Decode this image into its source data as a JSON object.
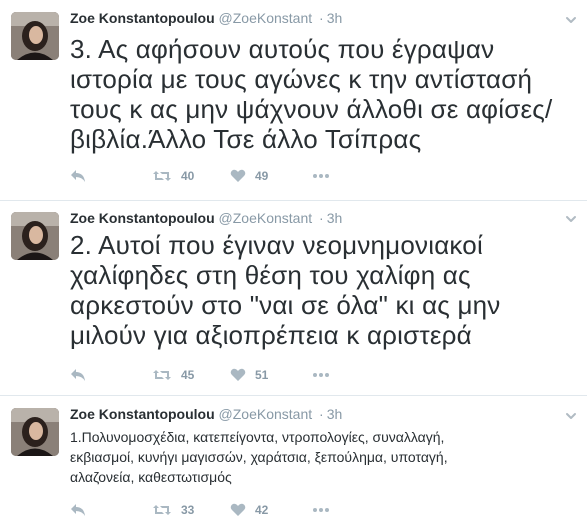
{
  "tweets": [
    {
      "author_name": "Zoe Konstantopoulou",
      "handle": "@ZoeKonstant",
      "separator": "·",
      "time": "3h",
      "text_lines": [
        "3. Ας αφήσουν αυτούς που έγραψαν",
        "ιστορία με τους αγώνες κ την αντίστασή",
        "τους κ ας μην ψάχνουν άλλοθι σε αφίσες/",
        "βιβλία.Άλλο Τσε άλλο  Τσίπρας"
      ],
      "retweets": "40",
      "likes": "49"
    },
    {
      "author_name": "Zoe Konstantopoulou",
      "handle": "@ZoeKonstant",
      "separator": "·",
      "time": "3h",
      "text_lines": [
        "2. Αυτοί που έγιναν νεομνημονιακοί",
        "χαλίφηδες στη θέση του χαλίφη ας",
        "αρκεστούν στο \"ναι σε όλα\" κι ας μην",
        "μιλούν για αξιοπρέπεια κ αριστερά"
      ],
      "retweets": "45",
      "likes": "51"
    },
    {
      "author_name": "Zoe Konstantopoulou",
      "handle": "@ZoeKonstant",
      "separator": "·",
      "time": "3h",
      "text_lines": [
        "1.Πολυνομοσχέδια, κατεπείγοντα, ντροπολογίες,  συναλλαγή,",
        "εκβιασμοί, κυνήγι μαγισσών, χαράτσια, ξεπούλημα, υποταγή,",
        "αλαζονεία, καθεστωτισμός"
      ],
      "retweets": "33",
      "likes": "42"
    }
  ],
  "icons": {
    "reply": "reply-icon",
    "retweet": "retweet-icon",
    "like": "heart-icon",
    "more": "more-dots-icon",
    "caret": "chevron-down-icon"
  },
  "colors": {
    "text": "#292f33",
    "secondary": "#8899a6",
    "divider": "#e1e8ed"
  }
}
